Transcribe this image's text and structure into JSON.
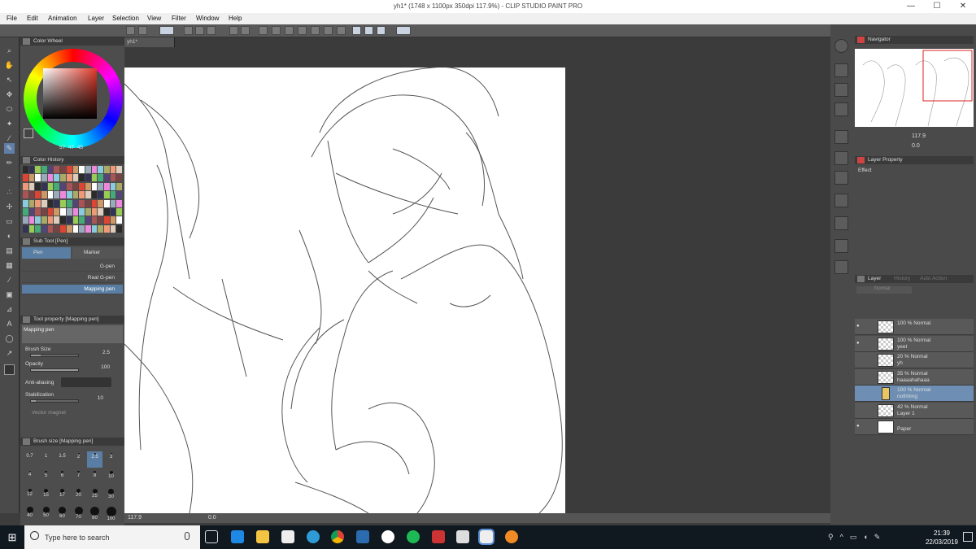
{
  "window": {
    "title": "yh1* (1748 x 1100px 350dpi 117.9%)  - CLIP STUDIO PAINT PRO",
    "minimize": "—",
    "maximize": "☐",
    "close": "✕"
  },
  "menu": [
    "File",
    "Edit",
    "Animation",
    "Layer",
    "Selection",
    "View",
    "Filter",
    "Window",
    "Help"
  ],
  "color_wheel": {
    "title": "Color Wheel",
    "values": [
      "57",
      "47",
      "45"
    ]
  },
  "color_history": {
    "title": "Color History"
  },
  "sub_tool": {
    "title": "Sub Tool [Pen]",
    "tabs": [
      "Pen",
      "Marker"
    ],
    "items": [
      "G-pen",
      "Real G-pen",
      "Mapping pen"
    ],
    "selected": "Mapping pen"
  },
  "tool_property": {
    "title": "Tool property [Mapping pen]",
    "preview_label": "Mapping pen",
    "brush_size_label": "Brush Size",
    "brush_size": "2.5",
    "opacity_label": "Opacity",
    "opacity": "100",
    "antialiasing_label": "Anti-aliasing",
    "stabilization_label": "Stabilization",
    "stabilization": "10",
    "vector_magnet_label": "Vector magnet"
  },
  "brush_size_panel": {
    "title": "Brush size [Mapping pen]",
    "sizes": [
      "0.7",
      "1",
      "1.5",
      "2",
      "2.5",
      "3",
      "4",
      "5",
      "6",
      "7",
      "8",
      "10",
      "12",
      "15",
      "17",
      "20",
      "25",
      "30",
      "40",
      "50",
      "60",
      "70",
      "80",
      "100"
    ],
    "selected": "2.5"
  },
  "document": {
    "tab": "yh1*",
    "zoom": "117.9",
    "angle": "0.0"
  },
  "navigator": {
    "title": "Navigator",
    "zoom": "117.9",
    "angle": "0.0"
  },
  "layer_property": {
    "title": "Layer Property",
    "effect_label": "Effect"
  },
  "layers_panel": {
    "tabs": [
      "Layer",
      "History",
      "Auto Action"
    ],
    "blend_mode": "Normal",
    "layers": [
      {
        "opacity_mode": "100 % Normal",
        "name": "",
        "visible": true
      },
      {
        "opacity_mode": "100 % Normal",
        "name": "yeet",
        "visible": true
      },
      {
        "opacity_mode": "20 % Normal",
        "name": "yh",
        "visible": false
      },
      {
        "opacity_mode": "35 % Normal",
        "name": "haaaahahaaa",
        "visible": false
      },
      {
        "opacity_mode": "100 % Normal",
        "name": "nothhing",
        "visible": false,
        "folder": true,
        "selected": true
      },
      {
        "opacity_mode": "42 % Normal",
        "name": "Layer 1",
        "visible": false
      },
      {
        "opacity_mode": "",
        "name": "Paper",
        "visible": true
      }
    ]
  },
  "taskbar": {
    "search_placeholder": "Type here to search",
    "time": "21:39",
    "date": "22/03/2019",
    "apps": [
      "task-view",
      "edge",
      "file-explorer",
      "store",
      "ie",
      "chrome",
      "japanese-app",
      "wps",
      "spotify",
      "game-app",
      "clip-studio",
      "clip-studio-paint",
      "other-app"
    ]
  },
  "colors": {
    "accent": "#5a7ea3",
    "panel": "#4d4d4d",
    "canvas_bg": "#3b3b3b"
  }
}
